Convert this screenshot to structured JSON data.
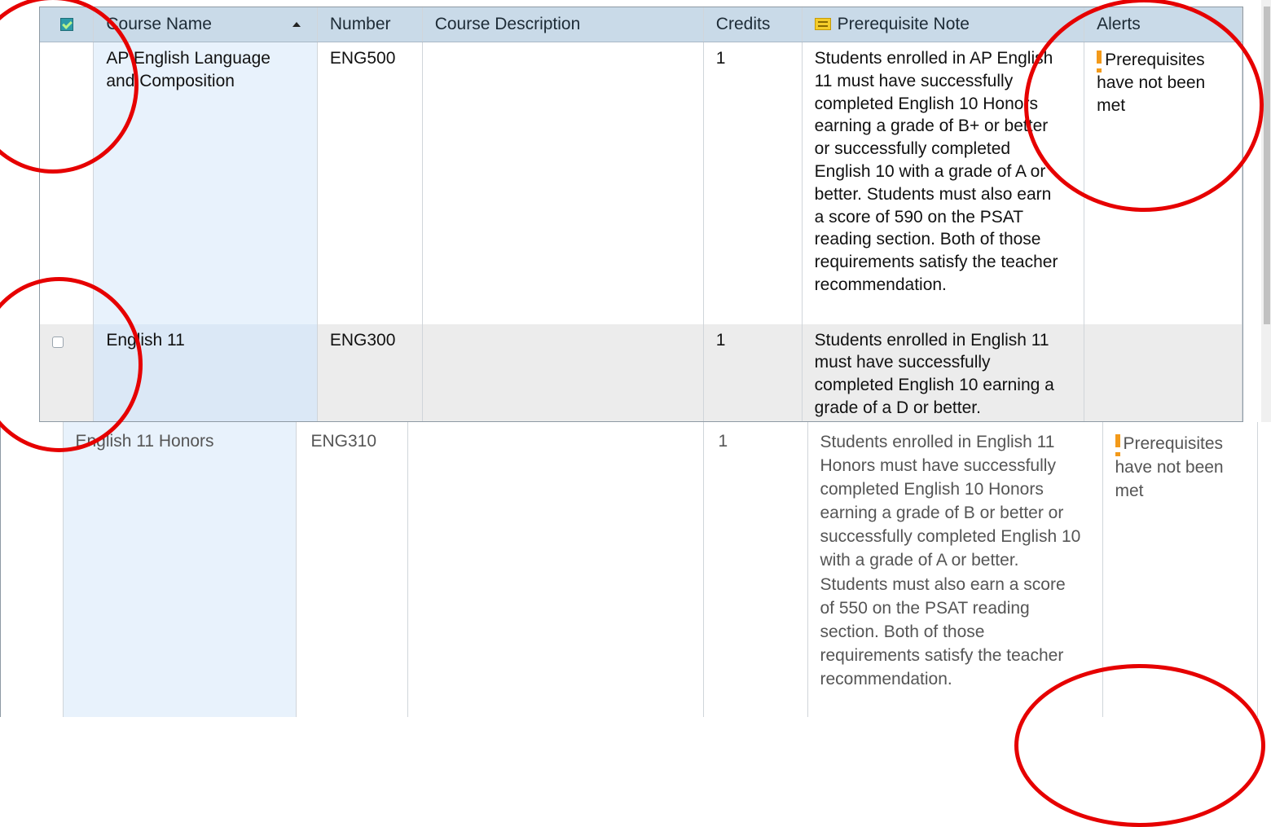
{
  "columns": {
    "course_name": "Course Name",
    "number": "Number",
    "course_description": "Course Description",
    "credits": "Credits",
    "prerequisite_note": "Prerequisite Note",
    "alerts": "Alerts"
  },
  "rows": [
    {
      "course_name": "AP English Language and Composition",
      "number": "ENG500",
      "course_description": "",
      "credits": "1",
      "prerequisite_note": "Students enrolled in AP English 11 must have successfully completed English 10 Honors earning a grade of B+ or better or successfully completed English 10 with a grade of A or better. Students must also earn a score of 590 on the PSAT reading section. Both of those requirements satisfy the teacher recommendation.",
      "alert": "Prerequisites have not been met",
      "selected": true
    },
    {
      "course_name": "English 11",
      "number": "ENG300",
      "course_description": "",
      "credits": "1",
      "prerequisite_note": "Students enrolled in English 11 must have successfully completed English 10 earning a grade of a D or better.",
      "alert": "",
      "selected": false
    },
    {
      "course_name": "English 11 Honors",
      "number": "ENG310",
      "course_description": "",
      "credits": "1",
      "prerequisite_note": "Students enrolled in English 11 Honors must have successfully completed English 10 Honors earning a grade of B or better or successfully completed English 10 with a grade of A or better. Students must also earn a score of 550 on the PSAT reading section. Both of those requirements satisfy the teacher recommendation.",
      "alert": "Prerequisites have not been met",
      "selected": false
    }
  ],
  "accent_colors": {
    "header_bg": "#c9dae8",
    "name_column_bg": "#e8f2fc",
    "alert_icon": "#f39a1a",
    "annotation_circle": "#e60000"
  },
  "icons": [
    "select-all-checkbox-icon",
    "sort-ascending-icon",
    "note-icon",
    "alert-exclamation-icon"
  ]
}
